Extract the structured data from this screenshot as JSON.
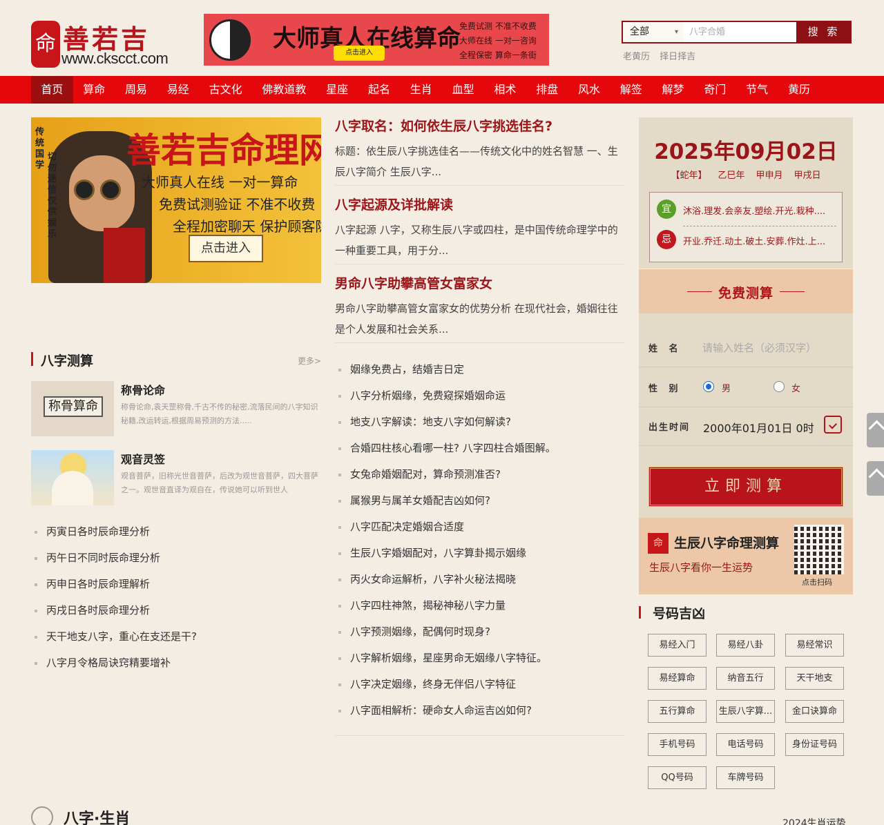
{
  "site": {
    "logo_seal": "命",
    "logo_name": "善若吉",
    "logo_url": "www.ckscct.com"
  },
  "top_banner": {
    "headline": "大师真人在线算命",
    "button": "点击进入",
    "side_text": [
      "免费试测 不准不收费",
      "大师在线 一对一咨询",
      "全程保密 算命一条街"
    ]
  },
  "search": {
    "scope": "全部",
    "placeholder": "八字合婚",
    "button": "搜 索"
  },
  "quick_links": [
    "老黄历",
    "择日择吉"
  ],
  "nav": [
    "首页",
    "算命",
    "周易",
    "易经",
    "古文化",
    "佛教道教",
    "星座",
    "起名",
    "生肖",
    "血型",
    "相术",
    "排盘",
    "风水",
    "解签",
    "解梦",
    "奇门",
    "节气",
    "黄历"
  ],
  "hero": {
    "title": "善若吉命理网",
    "line1": "大师真人在线 一对一算命",
    "line2": "免费试测验证 不准不收费",
    "line3": "全程加密聊天 保护顾客隐私",
    "button": "点击进入",
    "vertical1": "传统国学",
    "vertical2": "切勿迷信 仅供娱乐"
  },
  "featured": [
    {
      "title": "八字取名：如何依生辰八字挑选佳名?",
      "summary": "标题：依生辰八字挑选佳名——传统文化中的姓名智慧 一、生辰八字简介 生辰八字..."
    },
    {
      "title": "八字起源及详批解读",
      "summary": "八字起源 八字，又称生辰八字或四柱，是中国传统命理学中的一种重要工具，用于分..."
    },
    {
      "title": "男命八字助攀高管女富家女",
      "summary": "男命八字助攀高管女富家女的优势分析 在现代社会，婚姻往往是个人发展和社会关系..."
    }
  ],
  "main_list": [
    "姻缘免费占，结婚吉日定",
    "八字分析姻缘，免费窥探婚姻命运",
    "地支八字解读：地支八字如何解读?",
    "合婚四柱核心看哪一柱? 八字四柱合婚图解。",
    "女兔命婚姻配对，算命预测准否?",
    "属猴男与属羊女婚配吉凶如何?",
    "八字匹配决定婚姻合适度",
    "生辰八字婚姻配对，八字算卦揭示姻缘",
    "丙火女命运解析，八字补火秘法揭晓",
    "八字四柱神煞，揭秘神秘八字力量",
    "八字预测姻缘，配偶何时现身?",
    "八字解析姻缘，星座男命无姻缘八字特征。",
    "八字决定姻缘，终身无伴侣八字特征",
    "八字面相解析：硬命女人命运吉凶如何?"
  ],
  "bazi_section": {
    "title": "八字测算",
    "more": "更多>",
    "cards": [
      {
        "title": "称骨论命",
        "desc": "称骨论命,袁天罡称骨,千古不传的秘密,流落民间的八字知识秘籍,改运转运,根据周易预测的方法.....",
        "thumb_text": "称骨算命"
      },
      {
        "title": "观音灵签",
        "desc": "观音菩萨，旧称光世音菩萨，后改为观世音菩萨，四大菩萨之一。观世音直译为观自在，传说她可以听到世人"
      }
    ],
    "list": [
      "丙寅日各时辰命理分析",
      "丙午日不同时辰命理分析",
      "丙申日各时辰命理解析",
      "丙戌日各时辰命理分析",
      "天干地支八字，重心在支还是干?",
      "八字月令格局诀窍精要增补"
    ]
  },
  "bottom_section": {
    "title": "八字·生肖",
    "right_text": "2024生肖运势"
  },
  "calendar": {
    "date": "2025年09月02日",
    "ganzhi": [
      "【蛇年】",
      "乙巳年",
      "甲申月",
      "甲戌日"
    ],
    "yi_badge": "宜",
    "yi": "沐浴.理发.会亲友.塑绘.开光.栽种....",
    "ji_badge": "忌",
    "ji": "开业.乔迁.动土.破土.安葬.作灶.上...",
    "yi_color": "#5aa028",
    "ji_color": "#c0181e"
  },
  "free_test": {
    "title": "免费测算",
    "name_label": "姓 名",
    "name_placeholder": "请输入姓名（必须汉字）",
    "gender_label": "性 别",
    "male": "男",
    "female": "女",
    "birth_label": "出生时间",
    "birth_value": "2000年01月01日 0时",
    "submit": "立即测算"
  },
  "promo": {
    "icon": "命",
    "title": "生辰八字命理测算",
    "subtitle": "生辰八字看你一生运势",
    "qr_label": "点击扫码"
  },
  "number_section": {
    "title": "号码吉凶",
    "tags": [
      "易经入门",
      "易经八卦",
      "易经常识",
      "易经算命",
      "纳音五行",
      "天干地支",
      "五行算命",
      "生辰八字算...",
      "金口诀算命",
      "手机号码",
      "电话号码",
      "身份证号码",
      "QQ号码",
      "车牌号码"
    ]
  },
  "colors": {
    "brand_red": "#e4080d",
    "dark_red": "#9c1418",
    "background": "#f3ede4"
  }
}
